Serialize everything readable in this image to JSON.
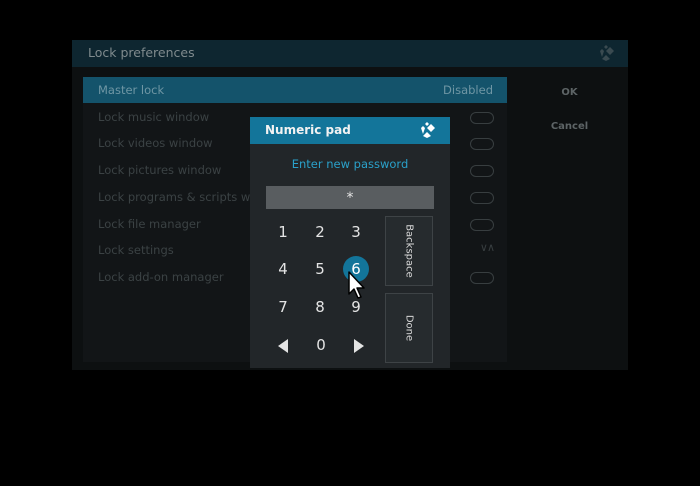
{
  "prefs": {
    "title": "Lock preferences",
    "items": [
      {
        "label": "Master lock",
        "value": "Disabled"
      },
      {
        "label": "Lock music window"
      },
      {
        "label": "Lock videos window"
      },
      {
        "label": "Lock pictures window"
      },
      {
        "label": "Lock programs & scripts window"
      },
      {
        "label": "Lock file manager"
      },
      {
        "label": "Lock settings"
      },
      {
        "label": "Lock add-on manager"
      }
    ],
    "ok_label": "OK",
    "cancel_label": "Cancel"
  },
  "numpad": {
    "title": "Numeric pad",
    "prompt": "Enter new password",
    "password_masked": "*",
    "keys": [
      "1",
      "2",
      "3",
      "4",
      "5",
      "6",
      "7",
      "8",
      "9",
      "0"
    ],
    "focused_key": "6",
    "backspace_label": "Backspace",
    "done_label": "Done"
  },
  "colors": {
    "accent": "#13759a",
    "prompt_text": "#2aa0c9"
  },
  "icons": {
    "app_logo": "kodi-logo-icon",
    "left": "left-arrow-icon",
    "right": "right-arrow-icon",
    "pointer": "mouse-pointer-icon"
  }
}
